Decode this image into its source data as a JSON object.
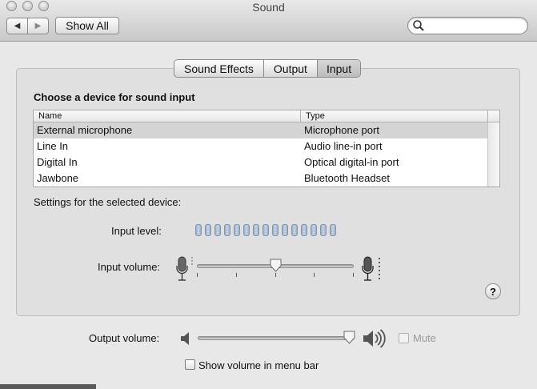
{
  "window": {
    "title": "Sound"
  },
  "toolbar": {
    "back_icon": "triangle-left",
    "forward_icon": "triangle-right",
    "show_all_label": "Show All",
    "search": {
      "value": "",
      "placeholder": ""
    }
  },
  "tabs": [
    {
      "label": "Sound Effects",
      "selected": false
    },
    {
      "label": "Output",
      "selected": false
    },
    {
      "label": "Input",
      "selected": true
    }
  ],
  "input": {
    "section_title": "Choose a device for sound input",
    "table": {
      "columns": [
        "Name",
        "Type"
      ],
      "rows": [
        {
          "name": "External microphone",
          "type": "Microphone port",
          "selected": true
        },
        {
          "name": "Line In",
          "type": "Audio line-in port",
          "selected": false
        },
        {
          "name": "Digital In",
          "type": "Optical digital-in port",
          "selected": false
        },
        {
          "name": "Jawbone",
          "type": "Bluetooth Headset",
          "selected": false
        }
      ]
    },
    "settings_label": "Settings for the selected device:",
    "input_level_label": "Input level:",
    "input_level_segments": 15,
    "input_level_lit": 0,
    "input_volume_label": "Input volume:",
    "input_volume_fraction": 0.5
  },
  "help_label": "?",
  "output": {
    "volume_label": "Output volume:",
    "volume_fraction": 1.0,
    "mute_label": "Mute",
    "mute_checked": false,
    "mute_enabled": false,
    "show_in_menu_bar_label": "Show volume in menu bar",
    "show_in_menu_bar_checked": false
  },
  "colors": {
    "selected_row": "#d4d4d4",
    "level_segment": "#b4c4da"
  }
}
